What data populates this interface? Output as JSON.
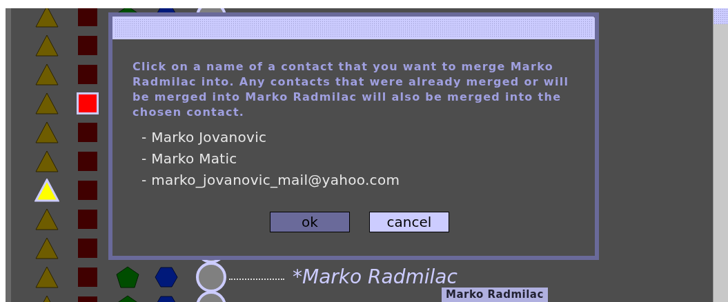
{
  "rows": [
    {
      "triangle_selected": false,
      "square_selected": false
    },
    {
      "triangle_selected": false,
      "square_selected": false
    },
    {
      "triangle_selected": false,
      "square_selected": false
    },
    {
      "triangle_selected": false,
      "square_selected": true
    },
    {
      "triangle_selected": false,
      "square_selected": false
    },
    {
      "triangle_selected": false,
      "square_selected": false
    },
    {
      "triangle_selected": true,
      "square_selected": false
    },
    {
      "triangle_selected": false,
      "square_selected": false
    },
    {
      "triangle_selected": false,
      "square_selected": false
    },
    {
      "triangle_selected": false,
      "square_selected": false,
      "name": "*Marko Radmilac"
    },
    {
      "triangle_selected": false,
      "square_selected": false
    }
  ],
  "dialog": {
    "message": "Click on a name of a contact that you want to merge Marko Radmilac into.  Any contacts that were already merged or will be merged into Marko Radmilac will also be merged into the chosen contact.",
    "contacts": [
      "- Marko Jovanovic",
      "- Marko Matic",
      "- marko_jovanovic_mail@yahoo.com"
    ],
    "buttons": [
      {
        "label": "ok",
        "kind": "primary"
      },
      {
        "label": "cancel",
        "kind": "secondary"
      }
    ]
  },
  "tooltip": "Marko Radmilac"
}
